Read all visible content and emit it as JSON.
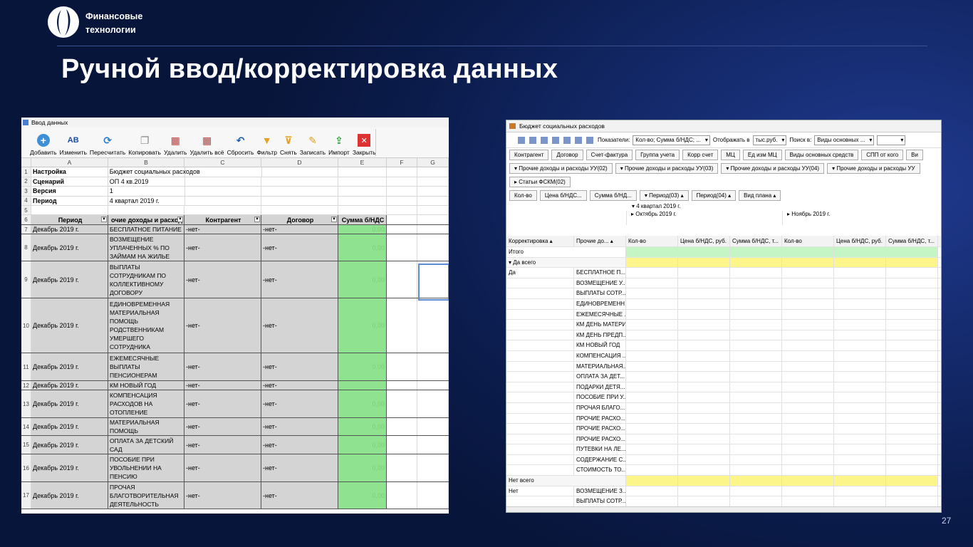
{
  "header": {
    "logo_line1": "Финансовые",
    "logo_line2": "технологии",
    "title": "Ручной ввод/корректировка данных",
    "page_number": "27"
  },
  "left_window": {
    "title": "Ввод данных",
    "toolbar": [
      "Добавить",
      "Изменить",
      "Пересчитать",
      "Копировать",
      "Удалить",
      "Удалить всё",
      "Сбросить",
      "Фильтр",
      "Снять",
      "Записать",
      "Импорт",
      "Закрыть"
    ],
    "columns": [
      "A",
      "B",
      "C",
      "D",
      "E",
      "F",
      "G"
    ],
    "settings": [
      {
        "n": "1",
        "label": "Настройка",
        "value": "Бюджет социальных расходов"
      },
      {
        "n": "2",
        "label": "Сценарий",
        "value": "ОП 4 кв.2019"
      },
      {
        "n": "3",
        "label": "Версия",
        "value": "1"
      },
      {
        "n": "4",
        "label": "Период",
        "value": "4 квартал 2019 г."
      }
    ],
    "empty_row": "5",
    "header_row": {
      "n": "6",
      "cols": [
        "Период",
        "очие доходы и расход",
        "Контрагент",
        "Договор",
        "Сумма б/НДС"
      ]
    },
    "rows": [
      {
        "n": "7",
        "period": "Декабрь 2019 г.",
        "item": "БЕСПЛАТНОЕ ПИТАНИЕ",
        "kontr": "-нет-",
        "dog": "-нет-",
        "sum": "0,00"
      },
      {
        "n": "8",
        "period": "Декабрь 2019 г.",
        "item": "ВОЗМЕЩЕНИЕ УПЛАЧЕННЫХ % ПО ЗАЙМАМ НА ЖИЛЬЕ",
        "kontr": "-нет-",
        "dog": "-нет-",
        "sum": "0,00"
      },
      {
        "n": "9",
        "period": "Декабрь 2019 г.",
        "item": "ВЫПЛАТЫ СОТРУДНИКАМ ПО КОЛЛЕКТИВНОМУ ДОГОВОРУ",
        "kontr": "-нет-",
        "dog": "-нет-",
        "sum": "0,00"
      },
      {
        "n": "10",
        "period": "Декабрь 2019 г.",
        "item": "ЕДИНОВРЕМЕННАЯ МАТЕРИАЛЬНАЯ ПОМОЩЬ РОДСТВЕННИКАМ УМЕРШЕГО СОТРУДНИКА",
        "kontr": "-нет-",
        "dog": "-нет-",
        "sum": "0,00"
      },
      {
        "n": "11",
        "period": "Декабрь 2019 г.",
        "item": "ЕЖЕМЕСЯЧНЫЕ ВЫПЛАТЫ ПЕНСИОНЕРАМ",
        "kontr": "-нет-",
        "dog": "-нет-",
        "sum": "0,00"
      },
      {
        "n": "12",
        "period": "Декабрь 2019 г.",
        "item": "КМ НОВЫЙ ГОД",
        "kontr": "-нет-",
        "dog": "-нет-",
        "sum": ""
      },
      {
        "n": "13",
        "period": "Декабрь 2019 г.",
        "item": "КОМПЕНСАЦИЯ РАСХОДОВ НА ОТОПЛЕНИЕ",
        "kontr": "-нет-",
        "dog": "-нет-",
        "sum": "0,00"
      },
      {
        "n": "14",
        "period": "Декабрь 2019 г.",
        "item": "МАТЕРИАЛЬНАЯ ПОМОЩЬ",
        "kontr": "-нет-",
        "dog": "-нет-",
        "sum": "0,00"
      },
      {
        "n": "15",
        "period": "Декабрь 2019 г.",
        "item": "ОПЛАТА ЗА ДЕТСКИЙ САД",
        "kontr": "-нет-",
        "dog": "-нет-",
        "sum": "0,00"
      },
      {
        "n": "16",
        "period": "Декабрь 2019 г.",
        "item": "ПОСОБИЕ ПРИ УВОЛЬНЕНИИ НА ПЕНСИЮ",
        "kontr": "-нет-",
        "dog": "-нет-",
        "sum": "0,00"
      },
      {
        "n": "17",
        "period": "Декабрь 2019 г.",
        "item": "ПРОЧАЯ БЛАГОТВОРИТЕЛЬНАЯ ДЕЯТЕЛЬНОСТЬ",
        "kontr": "-нет-",
        "dog": "-нет-",
        "sum": "0,00"
      }
    ]
  },
  "right_window": {
    "title": "Бюджет социальных расходов",
    "toolbar": {
      "pokazateli_label": "Показатели:",
      "pokazateli_value": "Кол-во; Сумма б/НДС; ...",
      "display_label": "Отображать в",
      "display_value": "тыс.руб.",
      "search_label": "Поиск в:",
      "search_value": "Виды основных ..."
    },
    "chips1": [
      "Контрагент",
      "Договор",
      "Счет-фактура",
      "Группа учета",
      "Корр счет",
      "МЦ",
      "Ед изм МЦ",
      "Виды основных средств",
      "СПП от кого",
      "Ви"
    ],
    "chips2": [
      "Прочие доходы и расходы УУ(02)",
      "Прочие доходы и расходы УУ(03)",
      "Прочие доходы и расходы УУ(04)",
      "Прочие доходы и расходы УУ"
    ],
    "chips3": [
      "Статьи ФСКМ(02)"
    ],
    "data_fields": [
      "Кол-во",
      "Цена б/НДС...",
      "Сумма б/НД..."
    ],
    "col_fields": [
      "Период(03)",
      "Период(04)",
      "Вид плана"
    ],
    "quarter": "4 квартал 2019 г.",
    "months": [
      "Октябрь 2019 г.",
      "Ноябрь 2019 г."
    ],
    "row_fields": [
      "Корректировка",
      "Прочие до..."
    ],
    "measure_headers": [
      "Кол-во",
      "Цена б/НДС, руб.",
      "Сумма б/НДС, т...",
      "Кол-во",
      "Цена б/НДС, руб.",
      "Сумма б/НДС, т..."
    ],
    "itogo": "Итого",
    "da_total": "Да всего",
    "da": "Да",
    "items": [
      "БЕСПЛАТНОЕ П...",
      "ВОЗМЕЩЕНИЕ У...",
      "ВЫПЛАТЫ СОТР...",
      "ЕДИНОВРЕМЕНН...",
      "ЕЖЕМЕСЯЧНЫЕ ...",
      "КМ ДЕНЬ МАТЕРИ",
      "КМ ДЕНЬ ПРЕДП...",
      "КМ НОВЫЙ ГОД",
      "КОМПЕНСАЦИЯ ...",
      "МАТЕРИАЛЬНАЯ...",
      "ОПЛАТА ЗА ДЕТ...",
      "ПОДАРКИ ДЕТЯ...",
      "ПОСОБИЕ ПРИ У...",
      "ПРОЧАЯ БЛАГО...",
      "ПРОЧИЕ РАСХО...",
      "ПРОЧИЕ РАСХО...",
      "ПРОЧИЕ РАСХО...",
      "ПУТЕВКИ НА ЛЕ...",
      "СОДЕРЖАНИЕ С...",
      "СТОИМОСТЬ ТО..."
    ],
    "net_total": "Нет всего",
    "net": "Нет",
    "net_items": [
      "ВОЗМЕЩЕНИЕ З...",
      "ВЫПЛАТЫ СОТР..."
    ]
  },
  "colors": {
    "accent_green": "#8fe28f",
    "header_gray": "#d4d4d4",
    "pivot_yellow": "#fbf58a",
    "pivot_green": "#c5f5c5"
  }
}
